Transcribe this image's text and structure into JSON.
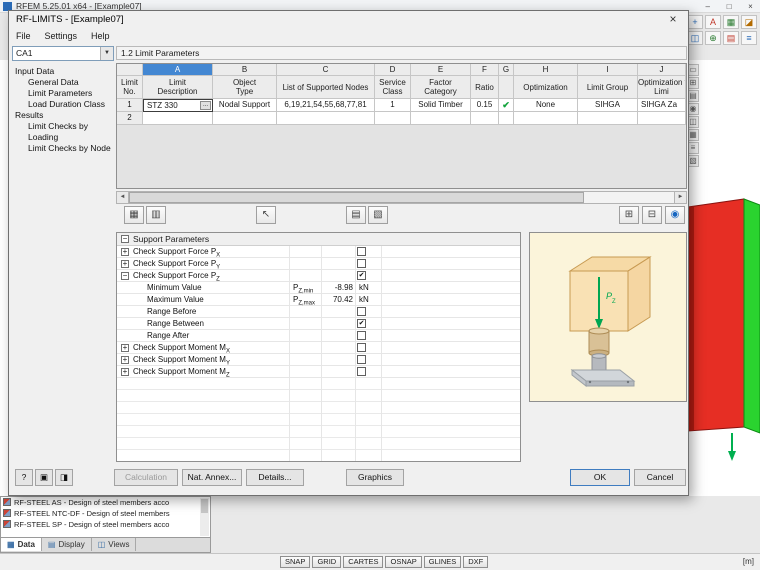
{
  "main": {
    "title": "RFEM 5.25.01 x64 - [Example07]",
    "controls": {
      "min": "–",
      "max": "□",
      "close": "×"
    },
    "toolbar_row1": [
      "+",
      "A",
      "▦",
      "◪"
    ],
    "toolbar_row2": [
      "◫",
      "⊕",
      "▤",
      "≡"
    ],
    "side_icons": [
      "▭",
      "⊞",
      "▤",
      "◉",
      "◫",
      "▦",
      "≡",
      "▧"
    ],
    "modules": [
      {
        "label": "RF-STEEL AS - Design of steel members acco"
      },
      {
        "label": "RF-STEEL NTC-DF - Design of steel members"
      },
      {
        "label": "RF-STEEL SP - Design of steel members acco"
      }
    ],
    "tabs": [
      {
        "icon": "▦",
        "label": "Data"
      },
      {
        "icon": "▤",
        "label": "Display"
      },
      {
        "icon": "◫",
        "label": "Views"
      }
    ],
    "status_buttons": [
      {
        "label": "SNAP"
      },
      {
        "label": "GRID"
      },
      {
        "label": "CARTES"
      },
      {
        "label": "OSNAP"
      },
      {
        "label": "GLINES"
      },
      {
        "label": "DXF"
      }
    ],
    "unit_label": "[m]"
  },
  "dialog": {
    "title": "RF-LIMITS - [Example07]",
    "close": "×",
    "menu": [
      {
        "label": "File"
      },
      {
        "label": "Settings"
      },
      {
        "label": "Help"
      }
    ],
    "case_value": "CA1",
    "combo_arrow": "▼",
    "nav_sections": [
      {
        "label": "Input Data",
        "items": [
          {
            "label": "General Data"
          },
          {
            "label": "Limit Parameters"
          },
          {
            "label": "Load Duration Class"
          }
        ]
      },
      {
        "label": "Results",
        "items": [
          {
            "label": "Limit Checks by Loading"
          },
          {
            "label": "Limit Checks by Node"
          }
        ]
      }
    ],
    "section_title": "1.2 Limit Parameters",
    "table": {
      "columns": [
        {
          "letter": "",
          "l1": "Limit",
          "l2": "No."
        },
        {
          "letter": "A",
          "l1": "Limit",
          "l2": "Description"
        },
        {
          "letter": "B",
          "l1": "Object",
          "l2": "Type"
        },
        {
          "letter": "C",
          "l1": "List of Supported Nodes",
          "l2": ""
        },
        {
          "letter": "D",
          "l1": "Service",
          "l2": "Class"
        },
        {
          "letter": "E",
          "l1": "Factor",
          "l2": "Category"
        },
        {
          "letter": "F",
          "l1": "Ratio",
          "l2": ""
        },
        {
          "letter": "G",
          "l1": "",
          "l2": ""
        },
        {
          "letter": "H",
          "l1": "Optimization",
          "l2": ""
        },
        {
          "letter": "I",
          "l1": "Limit Group",
          "l2": ""
        },
        {
          "letter": "J",
          "l1": "Optimization fro",
          "l2": "Limi"
        }
      ],
      "row1": {
        "no": "1",
        "description": "STZ 330",
        "browse": "...",
        "object_type": "Nodal Support",
        "nodes": "6,19,21,54,55,68,77,81",
        "service_class": "1",
        "factor_category": "Solid Timber",
        "ratio": "0.15",
        "check": "✔",
        "optimization": "None",
        "limit_group": "SIHGA",
        "optimization_from": "SIHGA Za"
      },
      "row2": {
        "no": "2"
      },
      "scroll_left": "◄",
      "scroll_right": "►",
      "toolbar_icons": [
        "▦",
        "▥",
        "↖",
        "▤",
        "▧",
        "⊞",
        "⊟",
        "◉"
      ]
    },
    "support": {
      "expand": "−",
      "title": "Support Parameters",
      "rows": [
        {
          "expand": "+",
          "label": "Check Support Force P",
          "sub": "X",
          "check": ""
        },
        {
          "expand": "+",
          "label": "Check Support Force P",
          "sub": "Y",
          "check": ""
        },
        {
          "expand": "−",
          "label": "Check Support Force P",
          "sub": "Z",
          "check": "✔"
        },
        {
          "label": "Minimum Value",
          "sym_base": "P",
          "sym_sub": "Z,min",
          "value": "-8.98",
          "unit": "kN"
        },
        {
          "label": "Maximum Value",
          "sym_base": "P",
          "sym_sub": "Z,max",
          "value": "70.42",
          "unit": "kN"
        },
        {
          "label": "Range Before",
          "check": ""
        },
        {
          "label": "Range Between",
          "check": "✔"
        },
        {
          "label": "Range After",
          "check": ""
        },
        {
          "expand": "+",
          "label": "Check Support Moment M",
          "sub": "X",
          "check": ""
        },
        {
          "expand": "+",
          "label": "Check Support Moment M",
          "sub": "Y",
          "check": ""
        },
        {
          "expand": "+",
          "label": "Check Support Moment M",
          "sub": "Z",
          "check": ""
        }
      ]
    },
    "picture": {
      "label_base": "P",
      "label_sub": "Z"
    },
    "footer": {
      "small_icons": [
        "?",
        "▣",
        "◨"
      ],
      "calculation": "Calculation",
      "nat_annex": "Nat. Annex...",
      "details": "Details...",
      "graphics": "Graphics",
      "ok": "OK",
      "cancel": "Cancel"
    }
  }
}
